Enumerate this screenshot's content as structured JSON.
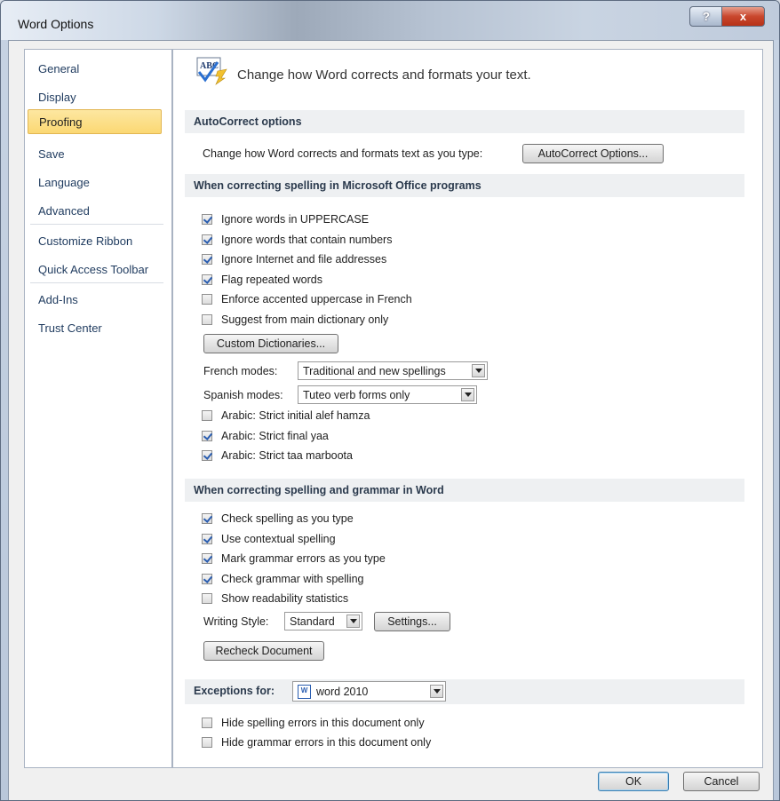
{
  "window": {
    "title": "Word Options",
    "help_glyph": "?",
    "close_glyph": "x"
  },
  "nav": {
    "items": [
      {
        "label": "General"
      },
      {
        "label": "Display"
      },
      {
        "label": "Proofing",
        "selected": true
      },
      {
        "label": "Save"
      },
      {
        "label": "Language"
      },
      {
        "label": "Advanced"
      },
      {
        "label": "Customize Ribbon"
      },
      {
        "label": "Quick Access Toolbar"
      },
      {
        "label": "Add-Ins"
      },
      {
        "label": "Trust Center"
      }
    ]
  },
  "header": {
    "text": "Change how Word corrects and formats your text.",
    "icon": "abc-proofing-icon",
    "icon_text": "ABC"
  },
  "autocorrect": {
    "section_title": "AutoCorrect options",
    "prompt": "Change how Word corrects and formats text as you type:",
    "button": "AutoCorrect Options..."
  },
  "office_spelling": {
    "section_title": "When correcting spelling in Microsoft Office programs",
    "options": [
      {
        "label": "Ignore words in UPPERCASE",
        "checked": true
      },
      {
        "label": "Ignore words that contain numbers",
        "checked": true
      },
      {
        "label": "Ignore Internet and file addresses",
        "checked": true
      },
      {
        "label": "Flag repeated words",
        "checked": true
      },
      {
        "label": "Enforce accented uppercase in French",
        "checked": false
      },
      {
        "label": "Suggest from main dictionary only",
        "checked": false
      }
    ],
    "custom_dict_button": "Custom Dictionaries...",
    "french_label": "French modes:",
    "french_value": "Traditional and new spellings",
    "spanish_label": "Spanish modes:",
    "spanish_value": "Tuteo verb forms only",
    "arabic_options": [
      {
        "label": "Arabic: Strict initial alef hamza",
        "checked": false
      },
      {
        "label": "Arabic: Strict final yaa",
        "checked": true
      },
      {
        "label": "Arabic: Strict taa marboota",
        "checked": true
      }
    ]
  },
  "word_grammar": {
    "section_title": "When correcting spelling and grammar in Word",
    "options": [
      {
        "label": "Check spelling as you type",
        "checked": true
      },
      {
        "label": "Use contextual spelling",
        "checked": true
      },
      {
        "label": "Mark grammar errors as you type",
        "checked": true
      },
      {
        "label": "Check grammar with spelling",
        "checked": true
      },
      {
        "label": "Show readability statistics",
        "checked": false
      }
    ],
    "writing_style_label": "Writing Style:",
    "writing_style_value": "Standard",
    "settings_button": "Settings...",
    "recheck_button": "Recheck Document"
  },
  "exceptions": {
    "label": "Exceptions for:",
    "document_value": "word 2010",
    "options": [
      {
        "label": "Hide spelling errors in this document only",
        "checked": false
      },
      {
        "label": "Hide grammar errors in this document only",
        "checked": false
      }
    ]
  },
  "footer": {
    "ok_button": "OK",
    "cancel_button": "Cancel"
  },
  "colors": {
    "selected_nav": "#fbd873",
    "section_bar": "#eef0f2",
    "check_mark": "#2a5db0"
  }
}
